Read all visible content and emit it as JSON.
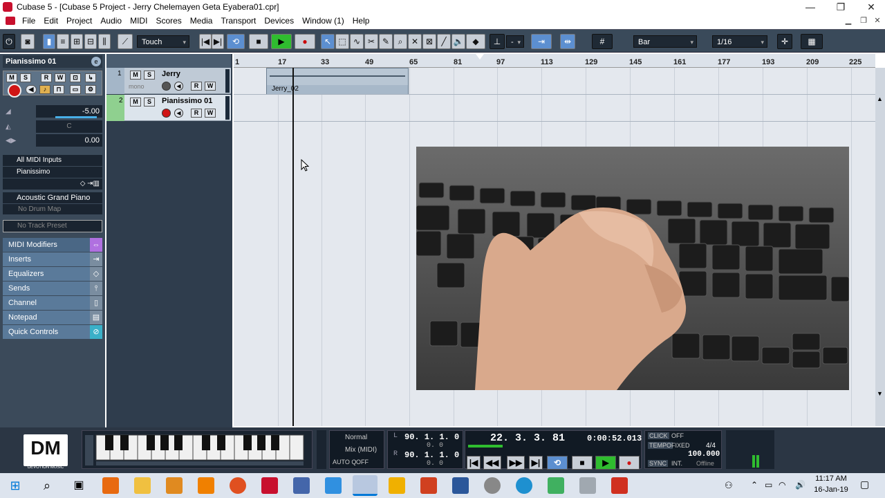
{
  "window": {
    "title": "Cubase 5 - [Cubase 5 Project - Jerry Chelemayen Geta Eyabera01.cpr]",
    "controls": [
      "—",
      "❐",
      "✕"
    ]
  },
  "menu": [
    "File",
    "Edit",
    "Project",
    "Audio",
    "MIDI",
    "Scores",
    "Media",
    "Transport",
    "Devices",
    "Window (1)",
    "Help"
  ],
  "toolbar": {
    "automation_mode": "Touch",
    "quantize_value": "-",
    "grid_type": "Bar",
    "quantize_preset": "1/16"
  },
  "inspector": {
    "track_name": "Pianissimo 01",
    "volume": "-5.00",
    "pan": "C",
    "delay": "0.00",
    "midi_input": "All MIDI Inputs",
    "midi_output": "Pianissimo",
    "program": "Acoustic Grand Piano",
    "drum_map": "No Drum Map",
    "track_preset": "No Track Preset",
    "sections": [
      "MIDI Modifiers",
      "Inserts",
      "Equalizers",
      "Sends",
      "Channel",
      "Notepad",
      "Quick Controls"
    ]
  },
  "tracks": [
    {
      "num": "1",
      "name": "Jerry",
      "sub": "mono"
    },
    {
      "num": "2",
      "name": "Pianissimo 01",
      "sub": ""
    }
  ],
  "ruler": [
    "1",
    "17",
    "33",
    "49",
    "65",
    "81",
    "97",
    "113",
    "129",
    "145",
    "161",
    "177",
    "193",
    "209",
    "225"
  ],
  "event": {
    "name": "Jerry_02"
  },
  "transport": {
    "mode": "Normal",
    "mix": "Mix (MIDI)",
    "autoq": "AUTO Q",
    "autoq_state": "OFF",
    "left_locator": "90. 1. 1.   0",
    "left_sub": "0.   0",
    "right_locator": "90. 1. 1.   0",
    "right_sub": "0.   0",
    "position_bars": "22. 3. 3.  81",
    "position_time": "0:00:52.013",
    "click_label": "CLICK",
    "click_state": "OFF",
    "tempo_label": "TEMPO",
    "tempo_mode": "FIXED",
    "signature": "4/4",
    "tempo": "100.000",
    "sync_label": "SYNC",
    "sync_source": "INT.",
    "sync_state": "Offline",
    "logo_text": "DM",
    "logo_sub": "DEVOTION MUSIC"
  },
  "taskbar": {
    "time": "11:17 AM",
    "date": "16-Jan-19"
  },
  "colors": {
    "green": "#2fbd2f",
    "record": "#d01515",
    "cycle": "#5c8fd0"
  }
}
